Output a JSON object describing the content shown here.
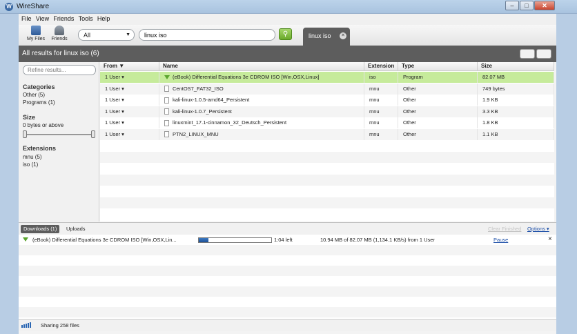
{
  "window": {
    "title": "WireShare"
  },
  "menu": [
    "File",
    "View",
    "Friends",
    "Tools",
    "Help"
  ],
  "toolbar": {
    "my_files": "My Files",
    "friends": "Friends",
    "search_category": "All",
    "search_query": "linux iso",
    "tab_label": "linux iso"
  },
  "results": {
    "title": "All results for linux iso (6)"
  },
  "filters": {
    "refine_placeholder": "Refine results...",
    "categories_heading": "Categories",
    "categories": [
      "Other (5)",
      "Programs (1)"
    ],
    "size_heading": "Size",
    "size_range": "0 bytes or above",
    "extensions_heading": "Extensions",
    "extensions": [
      "mnu (5)",
      "iso (1)"
    ]
  },
  "columns": [
    "From ▼",
    "Name",
    "Extension",
    "Type",
    "Size"
  ],
  "rows": [
    {
      "from": "1 User ▾",
      "name": "(eBook) Differential Equations 3e CDROM ISO [Win,OSX,Linux]",
      "ext": "iso",
      "type": "Program",
      "size": "82.07 MB",
      "downloading": true
    },
    {
      "from": "1 User ▾",
      "name": "CentOS7_FAT32_ISO",
      "ext": "mnu",
      "type": "Other",
      "size": "749 bytes",
      "downloading": false
    },
    {
      "from": "1 User ▾",
      "name": "kali-linux-1.0.5-amd64_Persistent",
      "ext": "mnu",
      "type": "Other",
      "size": "1.9 KB",
      "downloading": false
    },
    {
      "from": "1 User ▾",
      "name": "kali-linux-1.0.7_Persistent",
      "ext": "mnu",
      "type": "Other",
      "size": "3.3 KB",
      "downloading": false
    },
    {
      "from": "1 User ▾",
      "name": "linuxmint_17.1-cinnamon_32_Deutsch_Persistent",
      "ext": "mnu",
      "type": "Other",
      "size": "1.8 KB",
      "downloading": false
    },
    {
      "from": "1 User ▾",
      "name": "PTN2_LINUX_MNU",
      "ext": "mnu",
      "type": "Other",
      "size": "1.1 KB",
      "downloading": false
    }
  ],
  "downloads_panel": {
    "downloads_tab": "Downloads (1)",
    "uploads_tab": "Uploads",
    "clear_finished": "Clear Finished",
    "options": "Options ▾"
  },
  "downloads": [
    {
      "name": "(eBook) Differential Equations 3e CDROM ISO [Win,OSX,Lin...",
      "progress": 0.13,
      "time_left": "1:04 left",
      "detail": "10.94 MB of 82.07 MB (1,134.1 KB/s) from 1 User",
      "action": "Pause",
      "close": "×"
    }
  ],
  "statusbar": {
    "sharing": "Sharing 258 files"
  },
  "colors": {
    "selected_row": "#c6eb9b",
    "dark_bar": "#5d5d5d",
    "frame": "#b8cde4",
    "accent_green": "#6aa92a"
  }
}
